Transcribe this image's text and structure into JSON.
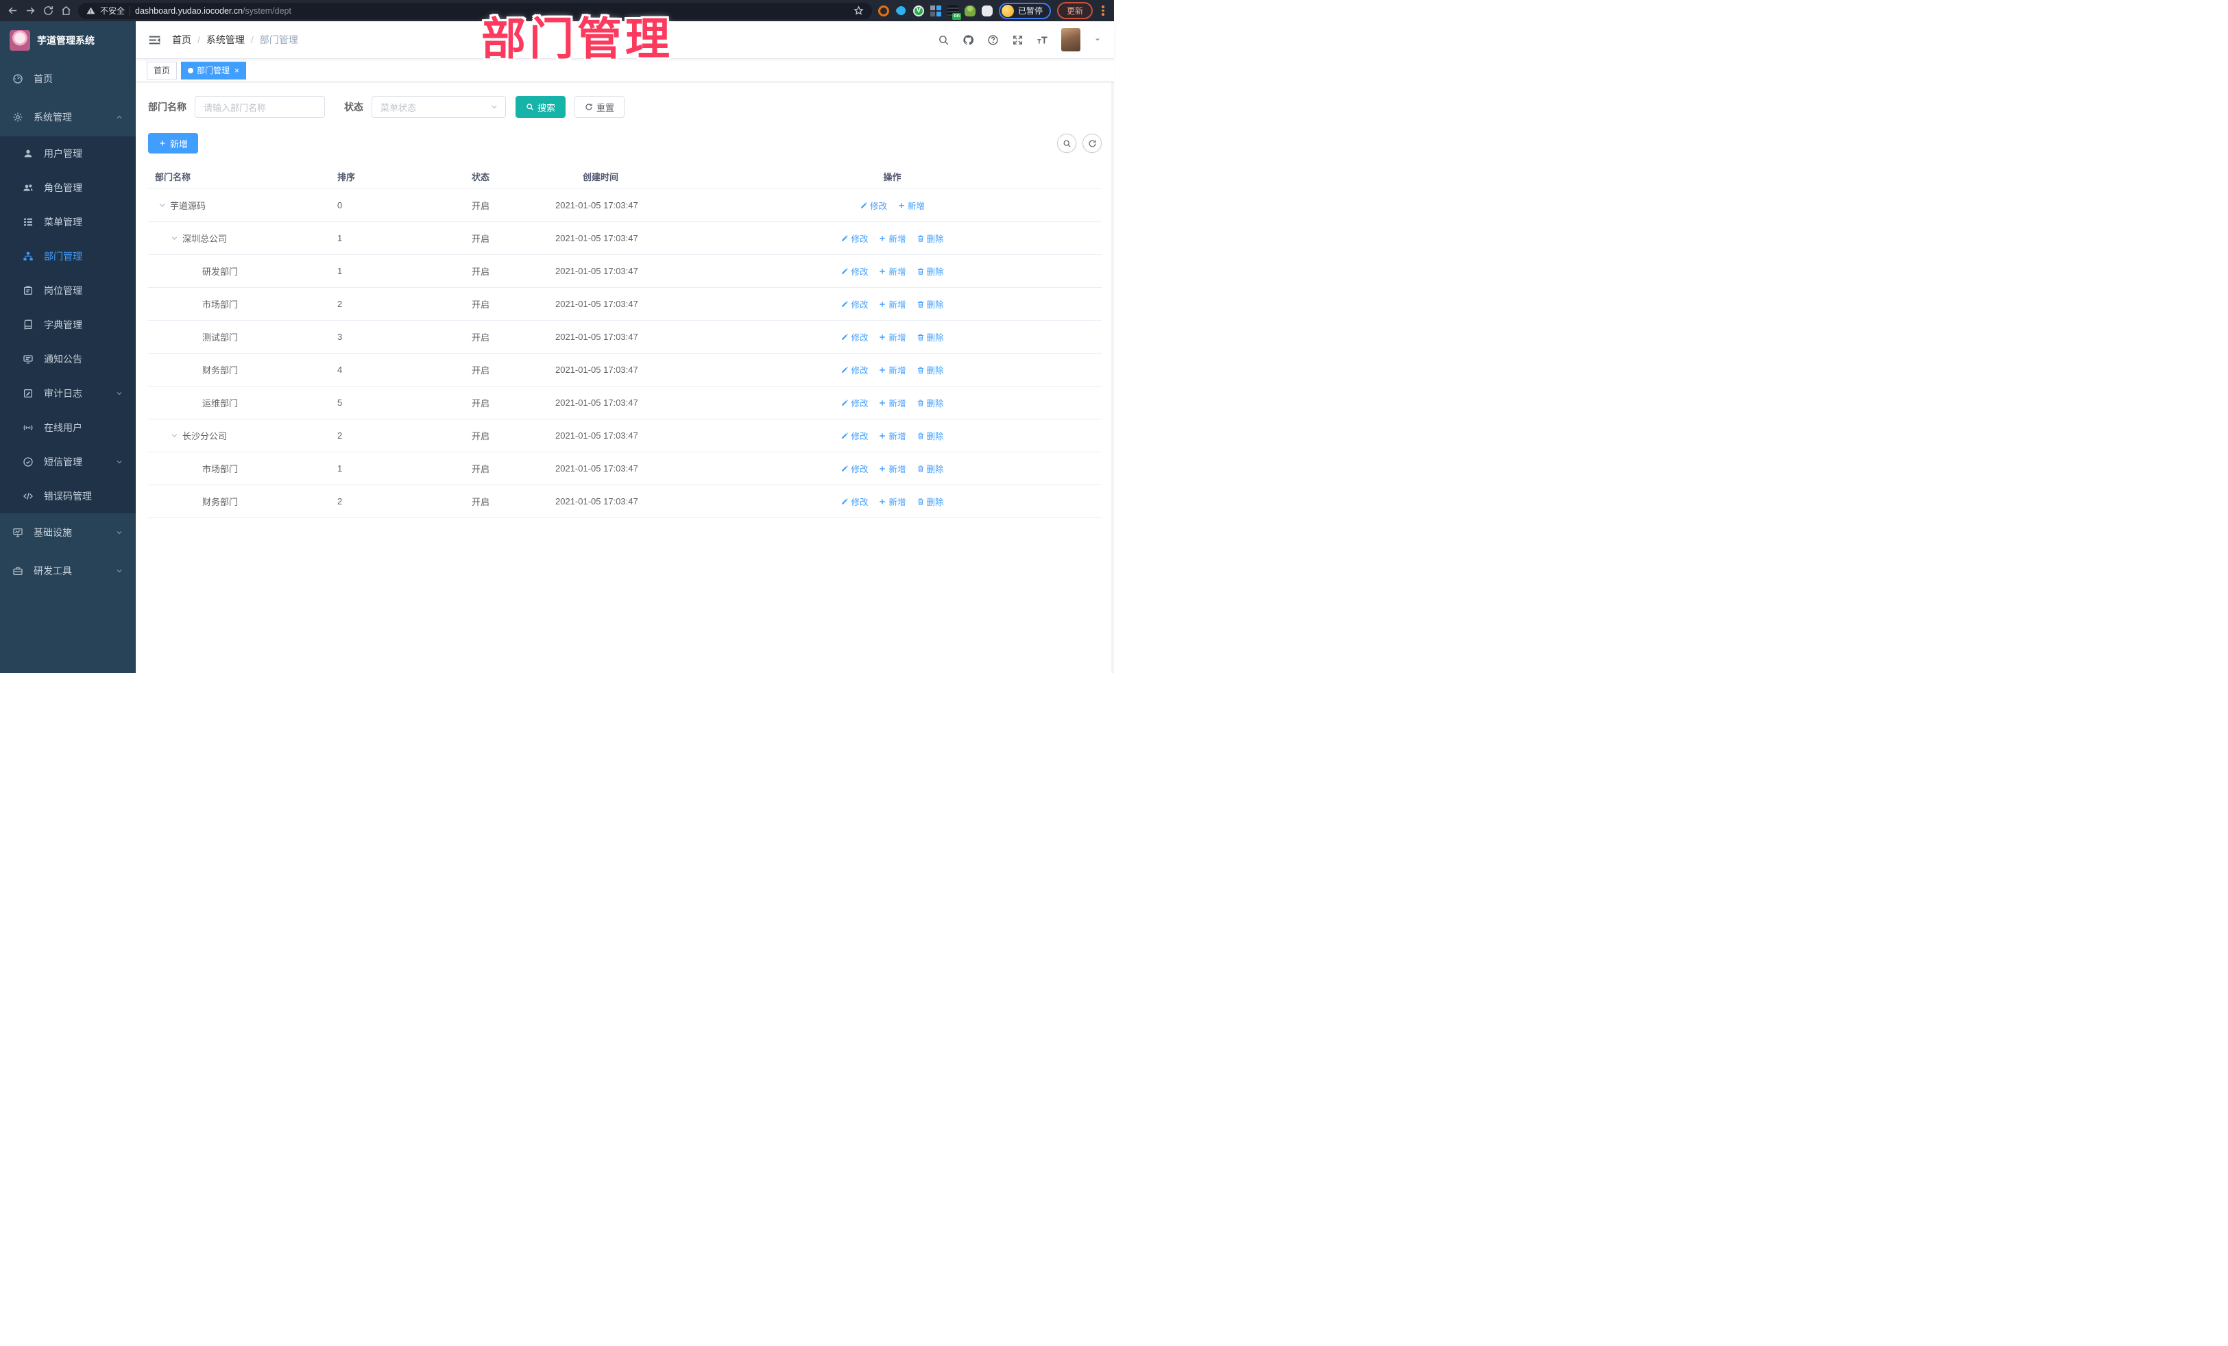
{
  "browser": {
    "security_label": "不安全",
    "url_host": "dashboard.yudao.iocoder.cn",
    "url_path": "/system/dept",
    "profile_status": "已暂停",
    "update_label": "更新"
  },
  "overlay": {
    "title": "部门管理",
    "color": "#fb3a5d"
  },
  "sidebar": {
    "app_title": "芋道管理系统",
    "items": [
      {
        "key": "home",
        "label": "首页",
        "icon": "dashboard-icon"
      },
      {
        "key": "system",
        "label": "系统管理",
        "icon": "gear-icon",
        "expanded": true,
        "children": [
          {
            "key": "user",
            "label": "用户管理",
            "icon": "user-icon"
          },
          {
            "key": "role",
            "label": "角色管理",
            "icon": "users-icon"
          },
          {
            "key": "menu",
            "label": "菜单管理",
            "icon": "menu-tree-icon"
          },
          {
            "key": "dept",
            "label": "部门管理",
            "icon": "org-chart-icon",
            "active": true
          },
          {
            "key": "post",
            "label": "岗位管理",
            "icon": "badge-icon"
          },
          {
            "key": "dict",
            "label": "字典管理",
            "icon": "dict-icon"
          },
          {
            "key": "notice",
            "label": "通知公告",
            "icon": "notice-icon"
          },
          {
            "key": "audit",
            "label": "审计日志",
            "icon": "audit-log-icon",
            "hasChildren": true
          },
          {
            "key": "online",
            "label": "在线用户",
            "icon": "online-user-icon"
          },
          {
            "key": "sms",
            "label": "短信管理",
            "icon": "sms-icon",
            "hasChildren": true
          },
          {
            "key": "errcode",
            "label": "错误码管理",
            "icon": "error-code-icon"
          }
        ]
      },
      {
        "key": "infra",
        "label": "基础设施",
        "icon": "infra-icon",
        "hasChildren": true
      },
      {
        "key": "tools",
        "label": "研发工具",
        "icon": "tools-icon",
        "hasChildren": true
      }
    ]
  },
  "header": {
    "breadcrumb": [
      "首页",
      "系统管理",
      "部门管理"
    ]
  },
  "tags": [
    {
      "key": "home",
      "label": "首页",
      "active": false,
      "closable": false
    },
    {
      "key": "dept",
      "label": "部门管理",
      "active": true,
      "closable": true
    }
  ],
  "filters": {
    "name_label": "部门名称",
    "name_placeholder": "请输入部门名称",
    "status_label": "状态",
    "status_placeholder": "菜单状态",
    "search_label": "搜索",
    "reset_label": "重置"
  },
  "toolbar": {
    "add_label": "新增"
  },
  "table": {
    "columns": [
      "部门名称",
      "排序",
      "状态",
      "创建时间",
      "操作"
    ],
    "rows": [
      {
        "name": "芋道源码",
        "level": 0,
        "expandable": true,
        "sort": "0",
        "status": "开启",
        "created": "2021-01-05 17:03:47",
        "actions": [
          {
            "key": "edit",
            "label": "修改",
            "icon": "edit-icon"
          },
          {
            "key": "add",
            "label": "新增",
            "icon": "plus-icon"
          }
        ]
      },
      {
        "name": "深圳总公司",
        "level": 1,
        "expandable": true,
        "sort": "1",
        "status": "开启",
        "created": "2021-01-05 17:03:47",
        "actions": [
          {
            "key": "edit",
            "label": "修改",
            "icon": "edit-icon"
          },
          {
            "key": "add",
            "label": "新增",
            "icon": "plus-icon"
          },
          {
            "key": "delete",
            "label": "删除",
            "icon": "delete-icon"
          }
        ]
      },
      {
        "name": "研发部门",
        "level": 2,
        "expandable": false,
        "sort": "1",
        "status": "开启",
        "created": "2021-01-05 17:03:47",
        "actions": [
          {
            "key": "edit",
            "label": "修改",
            "icon": "edit-icon"
          },
          {
            "key": "add",
            "label": "新增",
            "icon": "plus-icon"
          },
          {
            "key": "delete",
            "label": "删除",
            "icon": "delete-icon"
          }
        ]
      },
      {
        "name": "市场部门",
        "level": 2,
        "expandable": false,
        "sort": "2",
        "status": "开启",
        "created": "2021-01-05 17:03:47",
        "actions": [
          {
            "key": "edit",
            "label": "修改",
            "icon": "edit-icon"
          },
          {
            "key": "add",
            "label": "新增",
            "icon": "plus-icon"
          },
          {
            "key": "delete",
            "label": "删除",
            "icon": "delete-icon"
          }
        ]
      },
      {
        "name": "测试部门",
        "level": 2,
        "expandable": false,
        "sort": "3",
        "status": "开启",
        "created": "2021-01-05 17:03:47",
        "actions": [
          {
            "key": "edit",
            "label": "修改",
            "icon": "edit-icon"
          },
          {
            "key": "add",
            "label": "新增",
            "icon": "plus-icon"
          },
          {
            "key": "delete",
            "label": "删除",
            "icon": "delete-icon"
          }
        ]
      },
      {
        "name": "财务部门",
        "level": 2,
        "expandable": false,
        "sort": "4",
        "status": "开启",
        "created": "2021-01-05 17:03:47",
        "actions": [
          {
            "key": "edit",
            "label": "修改",
            "icon": "edit-icon"
          },
          {
            "key": "add",
            "label": "新增",
            "icon": "plus-icon"
          },
          {
            "key": "delete",
            "label": "删除",
            "icon": "delete-icon"
          }
        ]
      },
      {
        "name": "运维部门",
        "level": 2,
        "expandable": false,
        "sort": "5",
        "status": "开启",
        "created": "2021-01-05 17:03:47",
        "actions": [
          {
            "key": "edit",
            "label": "修改",
            "icon": "edit-icon"
          },
          {
            "key": "add",
            "label": "新增",
            "icon": "plus-icon"
          },
          {
            "key": "delete",
            "label": "删除",
            "icon": "delete-icon"
          }
        ]
      },
      {
        "name": "长沙分公司",
        "level": 1,
        "expandable": true,
        "sort": "2",
        "status": "开启",
        "created": "2021-01-05 17:03:47",
        "actions": [
          {
            "key": "edit",
            "label": "修改",
            "icon": "edit-icon"
          },
          {
            "key": "add",
            "label": "新增",
            "icon": "plus-icon"
          },
          {
            "key": "delete",
            "label": "删除",
            "icon": "delete-icon"
          }
        ]
      },
      {
        "name": "市场部门",
        "level": 2,
        "expandable": false,
        "sort": "1",
        "status": "开启",
        "created": "2021-01-05 17:03:47",
        "actions": [
          {
            "key": "edit",
            "label": "修改",
            "icon": "edit-icon"
          },
          {
            "key": "add",
            "label": "新增",
            "icon": "plus-icon"
          },
          {
            "key": "delete",
            "label": "删除",
            "icon": "delete-icon"
          }
        ]
      },
      {
        "name": "财务部门",
        "level": 2,
        "expandable": false,
        "sort": "2",
        "status": "开启",
        "created": "2021-01-05 17:03:47",
        "actions": [
          {
            "key": "edit",
            "label": "修改",
            "icon": "edit-icon"
          },
          {
            "key": "add",
            "label": "新增",
            "icon": "plus-icon"
          },
          {
            "key": "delete",
            "label": "删除",
            "icon": "delete-icon"
          }
        ]
      }
    ]
  },
  "colors": {
    "accent": "#409eff",
    "search_button": "#16b3a8",
    "sidebar_bg": "#284257",
    "submenu_bg": "#1f3247",
    "overlay_pink": "#fb3a5d"
  }
}
